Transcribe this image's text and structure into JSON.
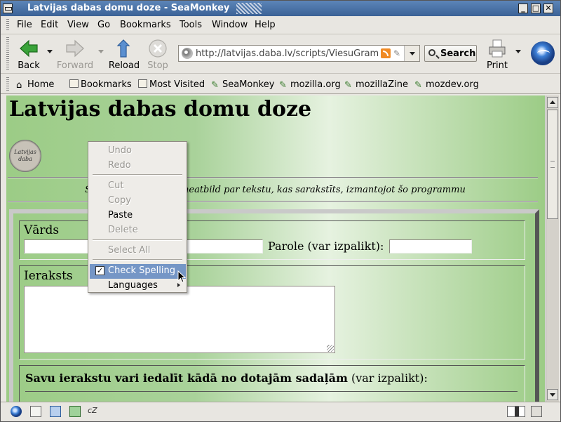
{
  "window": {
    "title": "Latvijas dabas domu doze - SeaMonkey",
    "buttons": {
      "minimize": "_",
      "maximize": "□",
      "close": "✕"
    }
  },
  "menubar": {
    "items": [
      "File",
      "Edit",
      "View",
      "Go",
      "Bookmarks",
      "Tools",
      "Window",
      "Help"
    ]
  },
  "navbar": {
    "back_label": "Back",
    "forward_label": "Forward",
    "reload_label": "Reload",
    "stop_label": "Stop",
    "url": "http://latvijas.daba.lv/scripts/ViesuGrama",
    "search_label": "Search",
    "print_label": "Print"
  },
  "personal_toolbar": {
    "items": [
      "Home",
      "Bookmarks",
      "Most Visited",
      "SeaMonkey",
      "mozilla.org",
      "mozillaZine",
      "mozdev.org"
    ]
  },
  "page": {
    "title": "Latvijas dabas domu doze",
    "seal_text_1": "Latvijas",
    "seal_text_2": "daba",
    "notice_start": "S",
    "notice": "neatbild par tekstu, kas sarakstīts, izmantojot šo programmu",
    "name_legend": "Vārds",
    "password_label": "Parole (var izpalikt):",
    "entry_legend": "Ieraksts",
    "sections_bold": "Savu ierakstu vari iedalīt kādā no dotajām sadaļām",
    "sections_note": "(var izpalikt):"
  },
  "context_menu": {
    "undo": "Undo",
    "redo": "Redo",
    "cut": "Cut",
    "copy": "Copy",
    "paste": "Paste",
    "delete": "Delete",
    "select_all": "Select All",
    "check_spelling": "Check Spelling",
    "check_spelling_checked": true,
    "languages": "Languages"
  },
  "icons": {
    "back": "back-arrow-icon",
    "forward": "forward-arrow-icon",
    "reload": "reload-icon",
    "stop": "stop-icon",
    "print": "printer-icon",
    "search": "magnifier-icon",
    "brand": "seamonkey-logo-icon"
  },
  "colors": {
    "titlebar": "#3b6296",
    "highlight": "#7596c6",
    "page_green": "#9ccc86",
    "back_green": "#3aa33a"
  }
}
